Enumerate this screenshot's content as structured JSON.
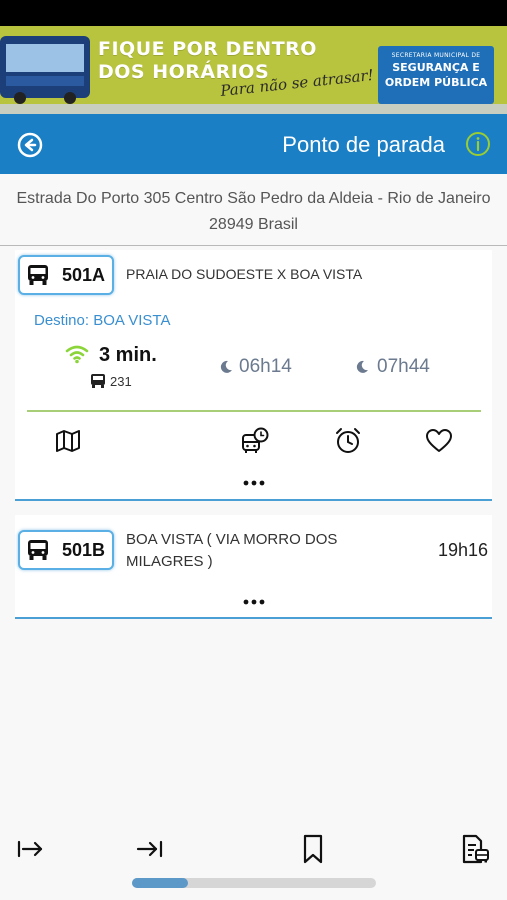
{
  "banner": {
    "title_line1": "FIQUE POR DENTRO",
    "title_line2": "DOS HORÁRIOS",
    "tagline": "Para não se atrasar!",
    "dept_small": "SECRETARIA MUNICIPAL DE",
    "dept_line1": "SEGURANÇA E",
    "dept_line2": "ORDEM PÚBLICA"
  },
  "header": {
    "title": "Ponto de parada",
    "back_icon": "back-circle-arrow-icon",
    "info_icon": "info-circle-icon",
    "color": "#1a7fc5",
    "info_color": "#9acd32"
  },
  "stop": {
    "address": "Estrada Do Porto 305 Centro São Pedro da Aldeia - Rio de Janeiro 28949 Brasil"
  },
  "routes": [
    {
      "code": "501A",
      "name": "PRAIA DO SUDOESTE X BOA VISTA",
      "destination": "Destino: BOA VISTA",
      "eta": "3 min.",
      "vehicle": "231",
      "realtime_icon": "wifi-signal-icon",
      "next_times": [
        "06h14",
        "07h44"
      ],
      "actions": [
        "map-icon",
        "bus-schedule-icon",
        "alarm-clock-icon",
        "heart-icon"
      ],
      "expanded": true
    },
    {
      "code": "501B",
      "name": "BOA VISTA ( VIA MORRO DOS MILAGRES )",
      "next_time": "19h16",
      "expanded": false
    }
  ],
  "bottom_nav": {
    "icons": [
      "arrow-right-to-bar-icon",
      "arrow-right-to-line-icon",
      "bookmark-icon",
      "document-bus-icon"
    ],
    "scroll_progress": 0.23
  },
  "colors": {
    "accent": "#1a7fc5",
    "card_border": "#4a9fd5",
    "divider_green": "#a8cf78",
    "realtime_green": "#8bd53a",
    "destination_blue": "#3a8fd0"
  }
}
